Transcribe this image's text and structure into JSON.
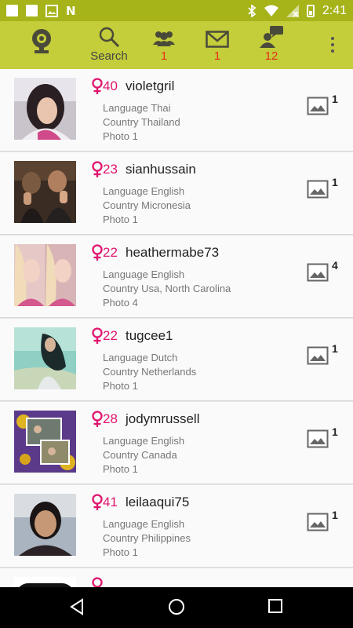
{
  "status_bar": {
    "time": "2:41"
  },
  "toolbar": {
    "search_label": "Search",
    "group_count": "1",
    "mail_count": "1",
    "chat_count": "12"
  },
  "colors": {
    "status_bar": "#a6b319",
    "toolbar": "#c4cd3a",
    "badge": "#e53018",
    "female_accent": "#e0156e"
  },
  "users": [
    {
      "age": "40",
      "username": "violetgril",
      "language": "Language Thai",
      "country": "Country Thailand",
      "photo": "Photo 1",
      "photo_count": "1",
      "gender_icon": "female-icon"
    },
    {
      "age": "23",
      "username": "sianhussain",
      "language": "Language English",
      "country": "Country Micronesia",
      "photo": "Photo 1",
      "photo_count": "1",
      "gender_icon": "female-icon"
    },
    {
      "age": "22",
      "username": "heathermabe73",
      "language": "Language English",
      "country": "Country Usa, North Carolina",
      "photo": "Photo 4",
      "photo_count": "4",
      "gender_icon": "female-icon"
    },
    {
      "age": "22",
      "username": "tugcee1",
      "language": "Language Dutch",
      "country": "Country Netherlands",
      "photo": "Photo 1",
      "photo_count": "1",
      "gender_icon": "female-icon"
    },
    {
      "age": "28",
      "username": "jodymrussell",
      "language": "Language English",
      "country": "Country Canada",
      "photo": "Photo 1",
      "photo_count": "1",
      "gender_icon": "female-icon"
    },
    {
      "age": "41",
      "username": "leilaaqui75",
      "language": "Language English",
      "country": "Country Philippines",
      "photo": "Photo 1",
      "photo_count": "1",
      "gender_icon": "female-icon"
    }
  ]
}
